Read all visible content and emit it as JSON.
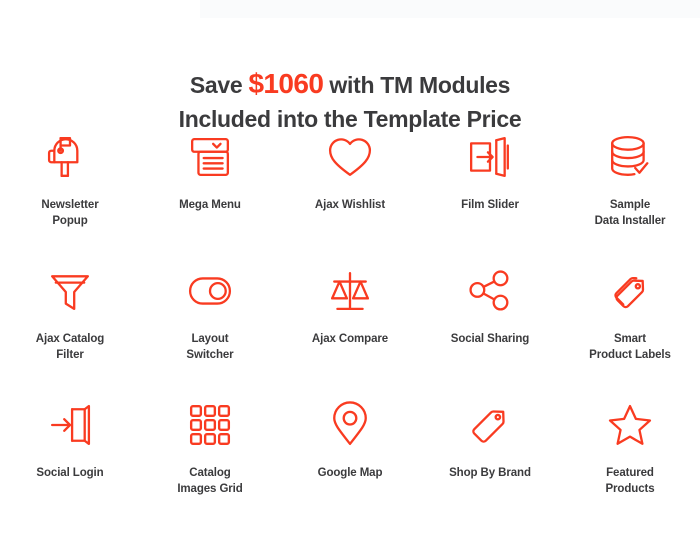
{
  "heading": {
    "prefix": "Save ",
    "amount": "$1060",
    "suffix": " with TM Modules",
    "line2": "Included into the Template Price"
  },
  "colors": {
    "accent": "#f93b21",
    "text": "#3b3b3d",
    "background": "#ffffff"
  },
  "modules": [
    {
      "label": "Newsletter\nPopup",
      "icon": "mailbox-icon"
    },
    {
      "label": "Mega Menu",
      "icon": "mega-menu-icon"
    },
    {
      "label": "Ajax Wishlist",
      "icon": "heart-icon"
    },
    {
      "label": "Film Slider",
      "icon": "slide-in-arrow-icon"
    },
    {
      "label": "Sample\nData Installer",
      "icon": "database-check-icon"
    },
    {
      "label": "Ajax Catalog\nFilter",
      "icon": "funnel-icon"
    },
    {
      "label": "Layout\nSwitcher",
      "icon": "toggle-switch-icon"
    },
    {
      "label": "Ajax Compare",
      "icon": "balance-scale-icon"
    },
    {
      "label": "Social Sharing",
      "icon": "share-nodes-icon"
    },
    {
      "label": "Smart\nProduct Labels",
      "icon": "double-tag-icon"
    },
    {
      "label": "Social Login",
      "icon": "login-door-icon"
    },
    {
      "label": "Catalog\nImages Grid",
      "icon": "grid-squares-icon"
    },
    {
      "label": "Google Map",
      "icon": "map-pin-icon"
    },
    {
      "label": "Shop By Brand",
      "icon": "tag-icon"
    },
    {
      "label": "Featured\nProducts",
      "icon": "star-icon"
    }
  ]
}
